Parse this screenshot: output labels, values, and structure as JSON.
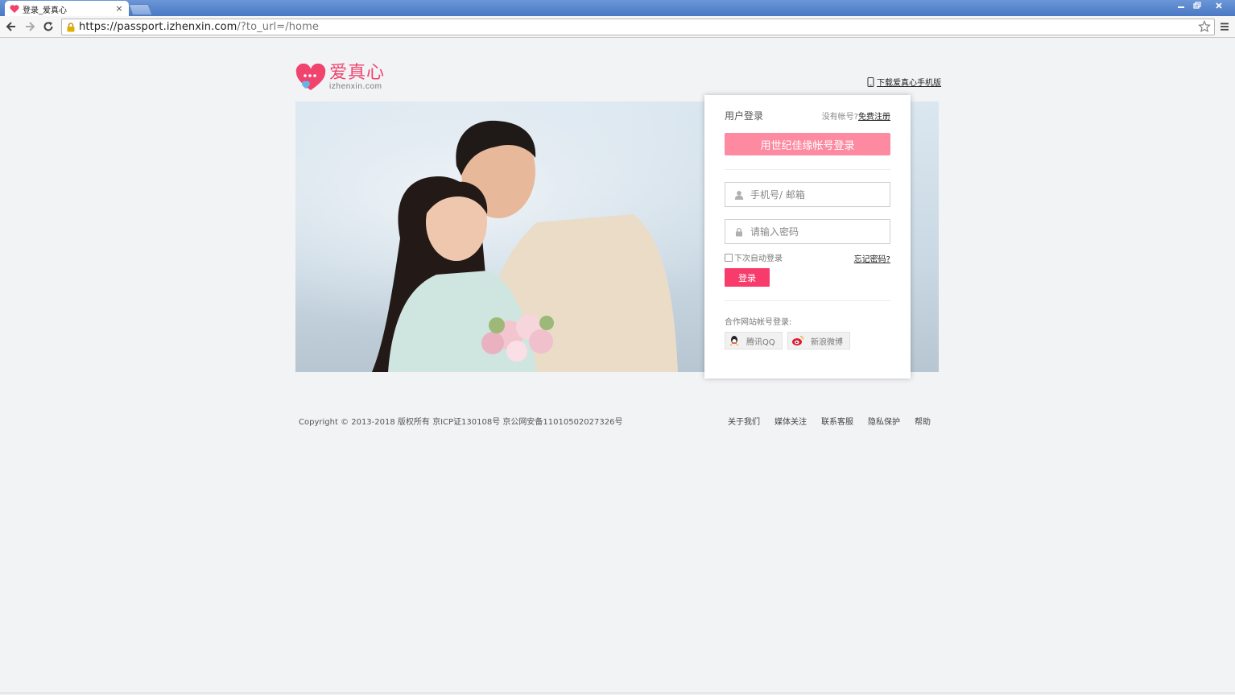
{
  "browser": {
    "tab_title": "登录_爱真心",
    "tab_close": "×",
    "url_host": "https://passport.izhenxin.com",
    "url_path": "/?to_url=/home",
    "window_controls": [
      "minimize-icon",
      "restore-icon",
      "close-icon"
    ]
  },
  "header": {
    "logo_cn": "爱真心",
    "logo_en": "izhenxin.com",
    "mobile_link": "下载爱真心手机版"
  },
  "login": {
    "title": "用户登录",
    "no_account": "没有帐号?",
    "register_link": "免费注册",
    "sjjy_button": "用世纪佳缘帐号登录",
    "account_placeholder": "手机号/ 邮箱",
    "password_placeholder": "请输入密码",
    "remember_label": "下次自动登录",
    "forgot_link": "忘记密码?",
    "login_button": "登录",
    "partner_label": "合作网站帐号登录:",
    "partners": [
      {
        "label": "腾讯QQ",
        "icon": "qq-icon"
      },
      {
        "label": "新浪微博",
        "icon": "weibo-icon"
      }
    ]
  },
  "footer": {
    "copyright": "Copyright © 2013-2018 版权所有 京ICP证130108号 京公网安备11010502027326号",
    "links": [
      "关于我们",
      "媒体关注",
      "联系客服",
      "隐私保护",
      "帮助"
    ]
  },
  "colors": {
    "accent": "#f73c6b",
    "accent_light": "#fd8aa0",
    "logo_pink": "#f0436e",
    "page_bg": "#f2f3f5"
  }
}
